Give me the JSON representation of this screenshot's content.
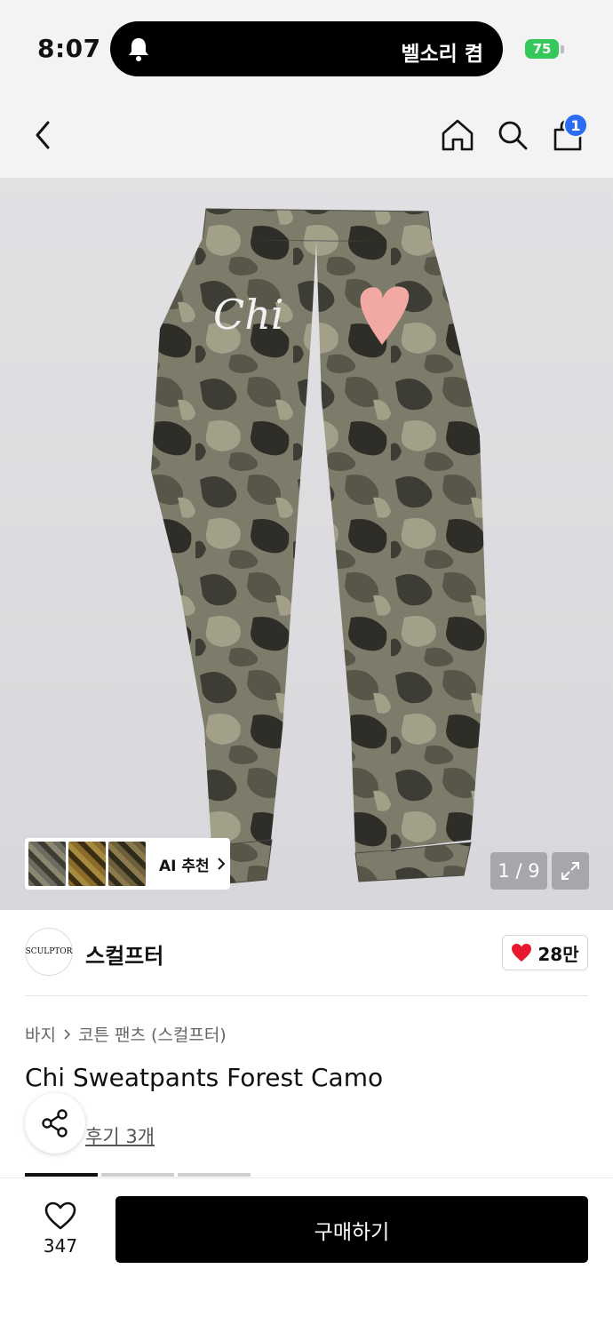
{
  "status_bar": {
    "time": "8:07",
    "island_text": "벨소리 켬",
    "battery": "75"
  },
  "nav": {
    "cart_count": "1"
  },
  "gallery": {
    "ai_label": "AI 추천",
    "counter": "1 / 9",
    "logo_text": "Chi"
  },
  "brand": {
    "logo_text": "SCULPTOR",
    "name": "스컬프터",
    "likes": "28만"
  },
  "product": {
    "breadcrumb": [
      "바지",
      "코튼 팬츠 (스컬프터)"
    ],
    "title": "Chi Sweatpants Forest Camo",
    "review_link": "후기 3개"
  },
  "bottom": {
    "wish_count": "347",
    "buy_label": "구매하기"
  },
  "colors": {
    "accent": "#2d6bf2",
    "heart": "#e8192c",
    "battery": "#34c759"
  }
}
